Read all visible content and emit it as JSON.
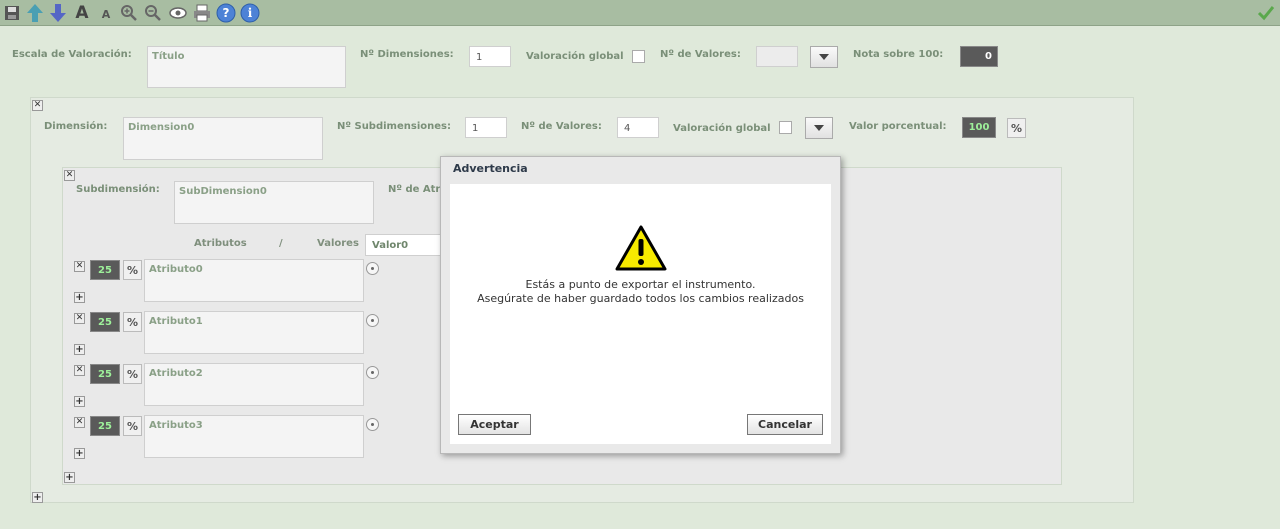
{
  "scale": {
    "label": "Escala de Valoración:",
    "title_value": "Título",
    "dims_label": "Nº Dimensiones:",
    "dims_value": "1",
    "global_label": "Valoración global",
    "values_label": "Nº de Valores:",
    "values_value": "",
    "note_label": "Nota sobre 100:",
    "note_value": "0"
  },
  "dimension": {
    "label": "Dimensión:",
    "name_value": "Dimension0",
    "subdims_label": "Nº Subdimensiones:",
    "subdims_value": "1",
    "values_label": "Nº de Valores:",
    "values_value": "4",
    "global_label": "Valoración global",
    "percent_label": "Valor porcentual:",
    "percent_value": "100"
  },
  "subdimension": {
    "label": "Subdimensión:",
    "name_value": "SubDimension0",
    "attrs_label": "Nº de Atri",
    "attributes_header": "Atributos",
    "slash": "/",
    "values_header": "Valores",
    "value0": "Valor0"
  },
  "attributes": [
    {
      "weight": "25",
      "name": "Atributo0"
    },
    {
      "weight": "25",
      "name": "Atributo1"
    },
    {
      "weight": "25",
      "name": "Atributo2"
    },
    {
      "weight": "25",
      "name": "Atributo3"
    }
  ],
  "dialog": {
    "title": "Advertencia",
    "line1": "Estás a punto de exportar el instrumento.",
    "line2": "Asegúrate de haber guardado todos los cambios realizados",
    "ok": "Aceptar",
    "cancel": "Cancelar"
  },
  "toolbar": {
    "big_a": "A",
    "small_a": "A",
    "help": "?",
    "info": "i"
  }
}
